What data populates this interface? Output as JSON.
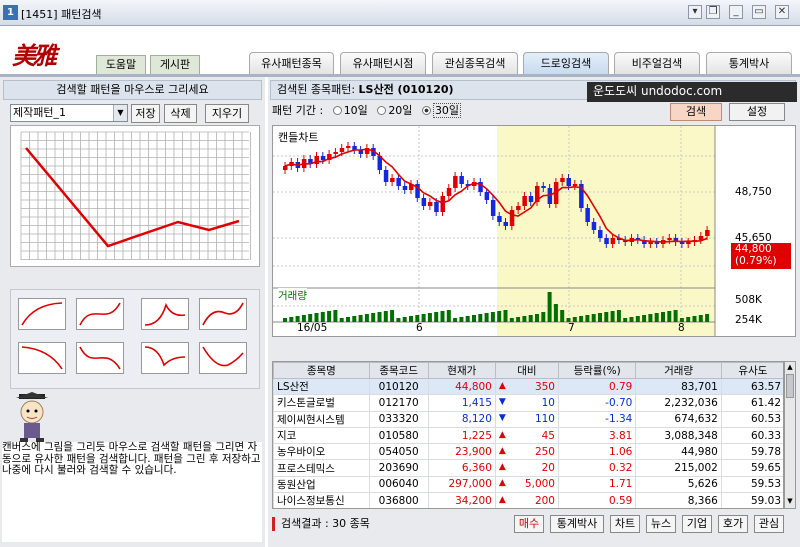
{
  "window": {
    "number": "1",
    "title": "[1451] 패턴검색",
    "min": "_",
    "restore": "❐",
    "max": "▭",
    "close": "✕",
    "menu": "▾"
  },
  "logo": {
    "text": "美雅門"
  },
  "top_buttons": {
    "help": "도움말",
    "board": "게시판"
  },
  "tabs": [
    "유사패턴종목",
    "유사패턴시점",
    "관심종목검색",
    "드로잉검색",
    "비주얼검색",
    "통계박사"
  ],
  "left": {
    "header": "검색할 패턴을 마우스로 그리세요",
    "pattern_select": "제작패턴_1",
    "save": "저장",
    "delete": "삭제",
    "clear": "지우기",
    "guide": "캔버스에 그림을 그리듯 마우스로 검색할 패턴을 그리면 자동으로 유사한 패턴을 검색합니다. 패턴을 그린 후 저장하고 나중에 다시 불러와 검색할 수 있습니다."
  },
  "right": {
    "header_label": "검색된 종목패턴:",
    "header_stock": "LS산전 (010120)",
    "watermark": "운도도씨 undodoc.com",
    "period_label": "패턴 기간 :",
    "periods": [
      "10일",
      "20일",
      "30일"
    ],
    "selected_period": "30일",
    "search": "검색",
    "settings": "설정",
    "chart_title": "캔들차트",
    "volume_title": "거래량",
    "price_labels": [
      "48,750",
      "45,650"
    ],
    "current_price": "44,800",
    "current_pct": "(0.79%)",
    "volume_labels": [
      "508K",
      "254K"
    ],
    "x_labels": [
      "16/05",
      "6",
      "7",
      "8"
    ]
  },
  "table": {
    "columns": [
      "종목명",
      "종목코드",
      "현재가",
      "대비",
      "등락률(%)",
      "거래량",
      "유사도"
    ],
    "rows": [
      {
        "name": "LS산전",
        "code": "010120",
        "price": "44,800",
        "dir": "up",
        "change": "350",
        "pct": "0.79",
        "vol": "83,701",
        "sim": "63.57"
      },
      {
        "name": "키스톤글로벌",
        "code": "012170",
        "price": "1,415",
        "dir": "dn",
        "change": "10",
        "pct": "-0.70",
        "vol": "2,232,036",
        "sim": "61.42"
      },
      {
        "name": "제이씨현시스템",
        "code": "033320",
        "price": "8,120",
        "dir": "dn",
        "change": "110",
        "pct": "-1.34",
        "vol": "674,632",
        "sim": "60.53"
      },
      {
        "name": "지코",
        "code": "010580",
        "price": "1,225",
        "dir": "up",
        "change": "45",
        "pct": "3.81",
        "vol": "3,088,348",
        "sim": "60.33"
      },
      {
        "name": "농우바이오",
        "code": "054050",
        "price": "23,900",
        "dir": "up",
        "change": "250",
        "pct": "1.06",
        "vol": "44,980",
        "sim": "59.78"
      },
      {
        "name": "프로스테믹스",
        "code": "203690",
        "price": "6,360",
        "dir": "up",
        "change": "20",
        "pct": "0.32",
        "vol": "215,002",
        "sim": "59.65"
      },
      {
        "name": "동원산업",
        "code": "006040",
        "price": "297,000",
        "dir": "up",
        "change": "5,000",
        "pct": "1.71",
        "vol": "5,626",
        "sim": "59.53"
      },
      {
        "name": "나이스정보통신",
        "code": "036800",
        "price": "34,200",
        "dir": "up",
        "change": "200",
        "pct": "0.59",
        "vol": "8,366",
        "sim": "59.03"
      }
    ]
  },
  "footer": {
    "result": "검색결과 : 30 종목",
    "buy": "매수",
    "stats": "통계박사",
    "chart": "차트",
    "news": "뉴스",
    "company": "기업",
    "quote": "호가",
    "interest": "관심"
  },
  "colors": {
    "candle_up": "#e00000",
    "candle_down": "#1428e0",
    "ma_line": "#e00000",
    "highlight": "#fbf8c8"
  }
}
